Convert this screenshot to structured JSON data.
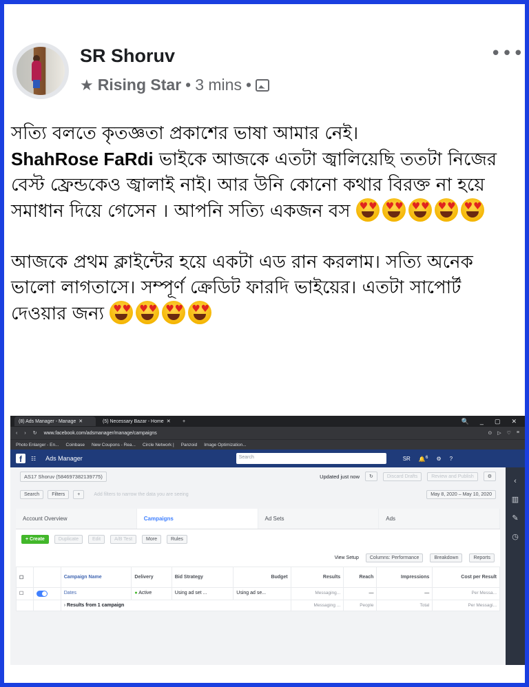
{
  "post": {
    "author": "SR Shoruv",
    "badge": "Rising Star",
    "sep": "•",
    "time": "3 mins",
    "more": "•••",
    "para1_before": "সত্যি বলতে কৃতজ্ঞতা প্রকাশের ভাষা আমার নেই।",
    "tagged_name": "ShahRose FaRdi",
    "para1_after": "ভাইকে আজকে এতটা জ্বালিয়েছি ততটা নিজের বেস্ট ফ্রেন্ডকেও জ্বালাই নাই। আর উনি কোনো কথার বিরক্ত না হয়ে সমাধান দিয়ে গেসেন । আপনি সত্যি একজন বস",
    "para2": "আজকে প্রথম ক্লাইন্টের হয়ে একটা এড রান করলাম। সত্যি অনেক ভালো লাগতাসে। সম্পূর্ণ ক্রেডিট ফারদি ভাইয়ের। এতটা সাপোর্ট দেওয়ার জন্য",
    "emoji_name": "heart-eyes-emoji",
    "emoji_count_1": 5,
    "emoji_count_2": 4
  },
  "browser": {
    "tab1": "(8) Ads Manager - Manage",
    "tab2": "(5) Necessary Bazar - Home",
    "url": "www.facebook.com/adsmanager/manage/campaigns",
    "bookmarks": [
      "Photo Enlarger - En...",
      "Coinbase",
      "New Coupons - Rea...",
      "Circle Network |",
      "Panzoid",
      "Image Optimization..."
    ]
  },
  "ads": {
    "app_title": "Ads Manager",
    "search_placeholder": "Search",
    "user": "SR",
    "notif_count": "6",
    "account": "AS17 Shoruv (584697382139775)",
    "updated": "Updated just now",
    "discard": "Discard Drafts",
    "review": "Review and Publish",
    "search_btn": "Search",
    "filters_btn": "Filters",
    "filter_hint": "Add filters to narrow the data you are seeing",
    "date_range": "May 8, 2020 – May 10, 2020",
    "tabs": [
      "Account Overview",
      "Campaigns",
      "Ad Sets",
      "Ads"
    ],
    "create": "+ Create",
    "duplicate": "Duplicate",
    "edit": "Edit",
    "ab_test": "A/B Test",
    "more": "More",
    "rules": "Rules",
    "view_setup": "View Setup",
    "columns": "Columns: Performance",
    "breakdown": "Breakdown",
    "reports": "Reports",
    "headers": [
      "Campaign Name",
      "Delivery",
      "Bid Strategy",
      "Budget",
      "Results",
      "Reach",
      "Impressions",
      "Cost per Result"
    ],
    "row": {
      "name": "Dates",
      "delivery": "Active",
      "bid": "Using ad set ...",
      "budget": "Using ad se...",
      "results_sub": "Messaging...",
      "reach": "—",
      "impressions": "—",
      "cost_sub": "Per Messa..."
    },
    "summary": {
      "label": "Results from 1 campaign",
      "results_sub": "Messaging ...",
      "reach_sub": "People",
      "impr_sub": "Total",
      "cost_sub": "Per Messagi..."
    }
  }
}
